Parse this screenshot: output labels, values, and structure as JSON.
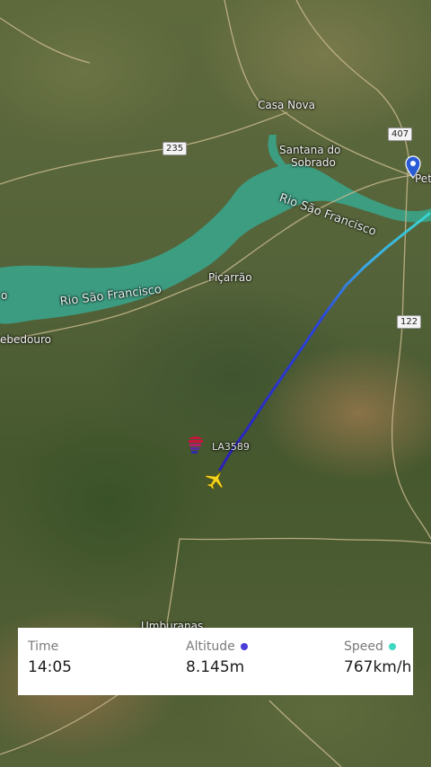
{
  "map": {
    "places": {
      "casa_nova": "Casa Nova",
      "santana_line1": "Santana do",
      "santana_line2": "Sobrado",
      "picarrao": "Piçarrão",
      "umburanas": "Umburanas",
      "sobradinho_partial": "ebedouro",
      "petrolina_partial": "Pet",
      "left_o": "o"
    },
    "rivers": {
      "upper": "Rio São Francisco",
      "lower": "Rio São Francisco"
    },
    "roads": {
      "br235": "235",
      "br407": "407",
      "br122": "122"
    },
    "flight_label": "LA3589",
    "icons": {
      "location_pin": "location-pin-icon",
      "airplane": "airplane-icon",
      "airline_logo": "latam-logo-icon"
    }
  },
  "info": {
    "time_label": "Time",
    "time_value": "14:05",
    "altitude_label": "Altitude",
    "altitude_value": "8.145m",
    "altitude_color": "#4a3fd9",
    "speed_label": "Speed",
    "speed_value": "767km/h",
    "speed_color": "#3fd9c2"
  }
}
